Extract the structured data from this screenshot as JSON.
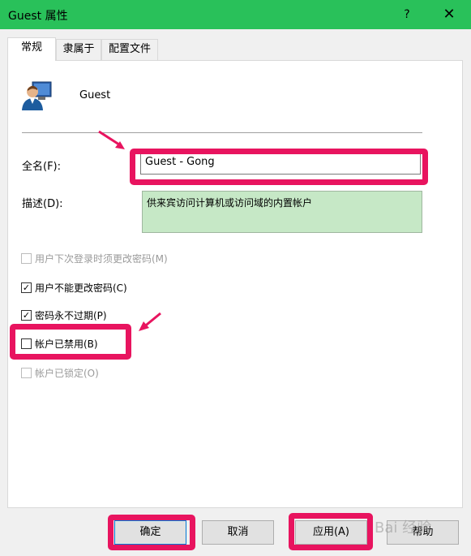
{
  "window": {
    "title": "Guest 属性",
    "help_label": "?",
    "close_label": "✕",
    "accent_color": "#29c15a"
  },
  "tabs": [
    {
      "label": "常规",
      "active": true
    },
    {
      "label": "隶属于",
      "active": false
    },
    {
      "label": "配置文件",
      "active": false
    }
  ],
  "general": {
    "user_name": "Guest",
    "user_icon": "user-account-icon",
    "fullname_label": "全名(F):",
    "fullname_value": "Guest - Gong",
    "description_label": "描述(D):",
    "description_value": "供来宾访问计算机或访问域的内置帐户",
    "checkboxes": [
      {
        "label": "用户下次登录时须更改密码(M)",
        "checked": false,
        "enabled": false
      },
      {
        "label": "用户不能更改密码(C)",
        "checked": true,
        "enabled": true
      },
      {
        "label": "密码永不过期(P)",
        "checked": true,
        "enabled": true
      },
      {
        "label": "帐户已禁用(B)",
        "checked": false,
        "enabled": true
      },
      {
        "label": "帐户已锁定(O)",
        "checked": false,
        "enabled": false
      }
    ]
  },
  "buttons": {
    "ok": "确定",
    "cancel": "取消",
    "apply": "应用(A)",
    "help": "帮助"
  },
  "annotations": {
    "highlight_color": "#e8145f"
  },
  "watermark": "Bai 经验"
}
